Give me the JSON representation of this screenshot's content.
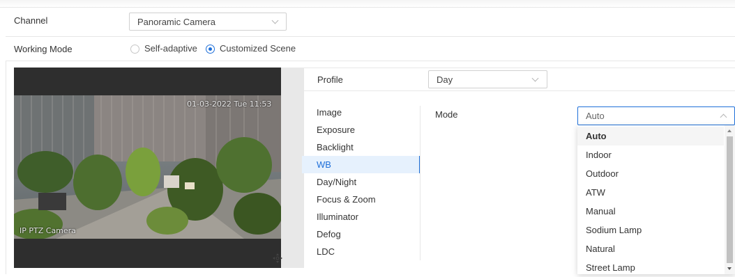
{
  "channel": {
    "label": "Channel",
    "value": "Panoramic Camera"
  },
  "working_mode": {
    "label": "Working Mode",
    "options": [
      {
        "label": "Self-adaptive",
        "selected": false
      },
      {
        "label": "Customized Scene",
        "selected": true
      }
    ]
  },
  "video": {
    "osd_name": "IP PTZ Camera",
    "osd_time": "01-03-2022 Tue 11:53",
    "ptz_icon": "move-arrows-icon"
  },
  "profile": {
    "label": "Profile",
    "value": "Day"
  },
  "menu": {
    "items": [
      "Image",
      "Exposure",
      "Backlight",
      "WB",
      "Day/Night",
      "Focus & Zoom",
      "Illuminator",
      "Defog",
      "LDC"
    ],
    "active": "WB"
  },
  "mode": {
    "label": "Mode",
    "value": "Auto",
    "options": [
      "Auto",
      "Indoor",
      "Outdoor",
      "ATW",
      "Manual",
      "Sodium Lamp",
      "Natural",
      "Street Lamp"
    ]
  },
  "colors": {
    "accent": "#1e6fd9",
    "active_bg": "#e6f1fd",
    "border": "#e6e6e6"
  }
}
